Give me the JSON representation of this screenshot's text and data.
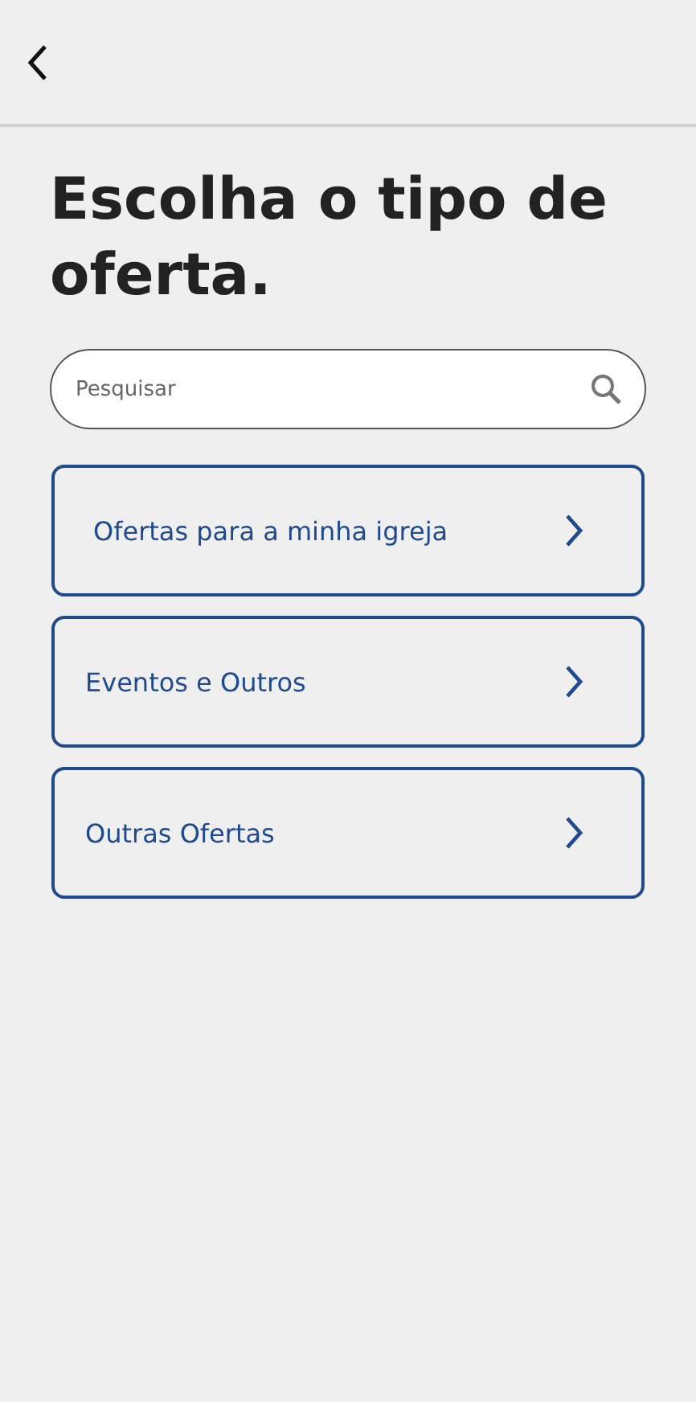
{
  "title": "Escolha o tipo de oferta.",
  "search": {
    "placeholder": "Pesquisar"
  },
  "options": [
    {
      "label": "Ofertas para a minha igreja"
    },
    {
      "label": "Eventos e Outros"
    },
    {
      "label": "Outras Ofertas"
    }
  ]
}
